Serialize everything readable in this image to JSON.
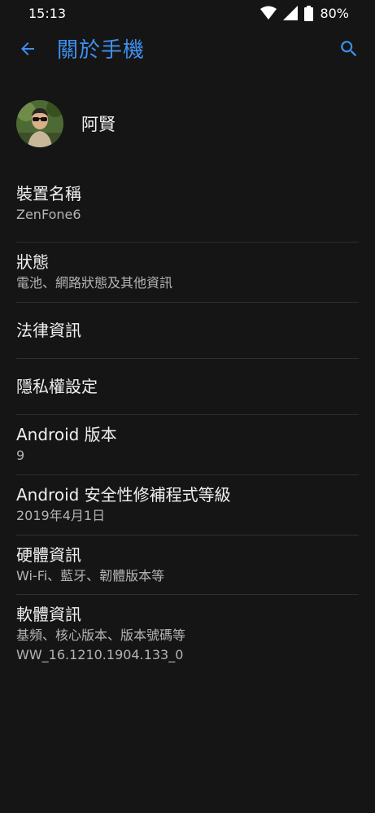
{
  "status_bar": {
    "time": "15:13",
    "battery": "80%",
    "icons": [
      "wifi-icon",
      "cell-signal-icon",
      "battery-icon"
    ]
  },
  "app_bar": {
    "title": "關於手機",
    "back_icon": "arrow-left-icon",
    "search_icon": "search-icon"
  },
  "profile": {
    "name": "阿賢"
  },
  "items": [
    {
      "title": "裝置名稱",
      "subtitle": "ZenFone6"
    },
    {
      "title": "狀態",
      "subtitle": "電池、網路狀態及其他資訊"
    },
    {
      "title": "法律資訊"
    },
    {
      "title": "隱私權設定"
    },
    {
      "title": "Android 版本",
      "subtitle": "9"
    },
    {
      "title": "Android 安全性修補程式等級",
      "subtitle": "2019年4月1日"
    },
    {
      "title": "硬體資訊",
      "subtitle": "Wi-Fi、藍牙、韌體版本等"
    },
    {
      "title": "軟體資訊",
      "subtitle": "基頻、核心版本、版本號碼等",
      "subtitle2": "WW_16.1210.1904.133_0"
    }
  ],
  "colors": {
    "background": "#151515",
    "accent": "#3f8ff0",
    "primary_text": "#f0f0f0",
    "secondary_text": "#b4b4b4"
  }
}
